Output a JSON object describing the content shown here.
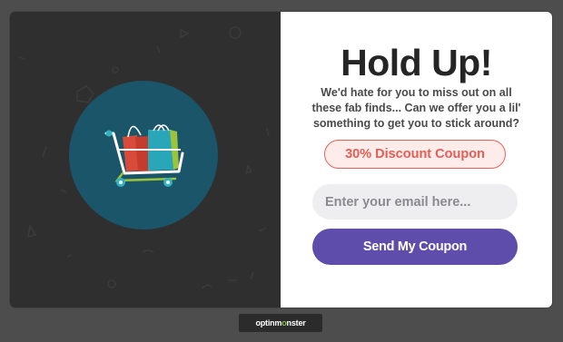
{
  "popup": {
    "headline": "Hold Up!",
    "subtext": "We'd hate for you to miss out on all these fab finds... Can we offer you a lil' something to get you to stick around?",
    "coupon_label": "30% Discount Coupon",
    "email_placeholder": "Enter your email here...",
    "submit_label": "Send My Coupon"
  },
  "badge": {
    "prefix": "optinm",
    "mark": "o",
    "suffix": "nster"
  },
  "illustration": {
    "icon": "shopping-cart-with-bags-icon"
  },
  "colors": {
    "page_background": "#4d4d4d",
    "left_panel": "#2f2f2f",
    "icon_circle": "#1b5569",
    "coupon_text": "#e35d55",
    "button": "#5f4dab"
  }
}
